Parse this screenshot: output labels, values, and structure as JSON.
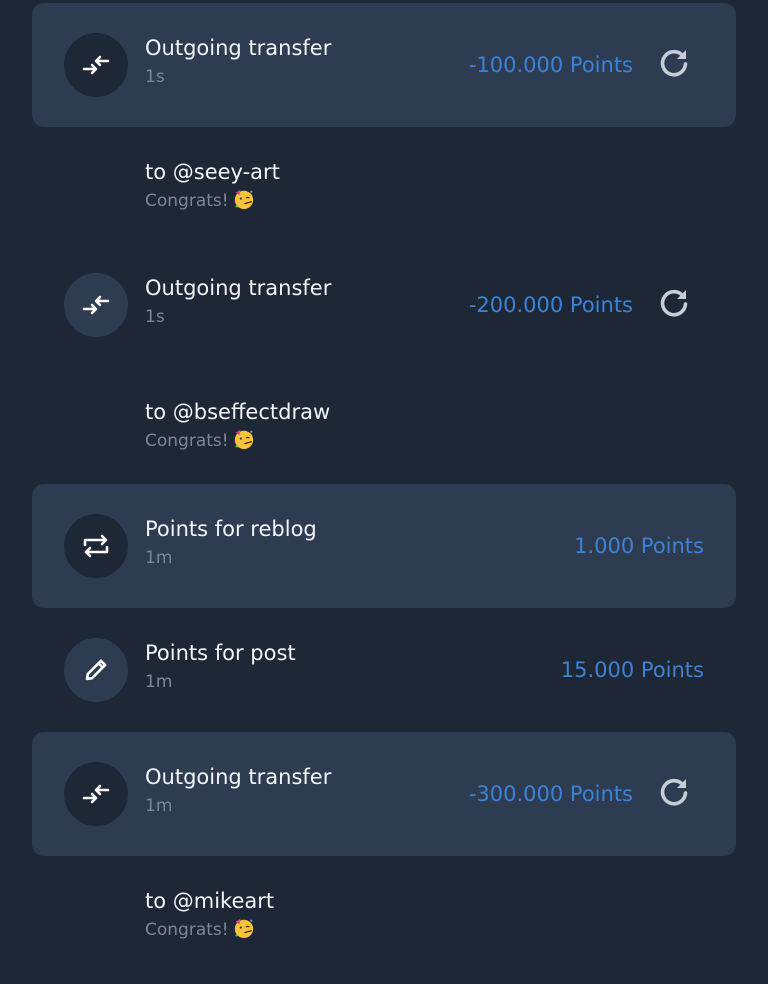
{
  "activities": [
    {
      "type": "transfer",
      "icon": "transfer-icon",
      "title": "Outgoing transfer",
      "time": "1s",
      "amount": "-100.000 Points",
      "highlighted": true,
      "has_repeat": true,
      "memo": {
        "to": "to @seey-art",
        "text": "Congrats!",
        "emoji": "partying-face-emoji"
      }
    },
    {
      "type": "transfer",
      "icon": "transfer-icon",
      "title": "Outgoing transfer",
      "time": "1s",
      "amount": "-200.000 Points",
      "highlighted": false,
      "has_repeat": true,
      "memo": {
        "to": "to @bseffectdraw",
        "text": "Congrats!",
        "emoji": "partying-face-emoji"
      }
    },
    {
      "type": "reblog",
      "icon": "reblog-icon",
      "title": "Points for reblog",
      "time": "1m",
      "amount": "1.000 Points",
      "highlighted": true,
      "has_repeat": false
    },
    {
      "type": "post",
      "icon": "pencil-icon",
      "title": "Points for post",
      "time": "1m",
      "amount": "15.000 Points",
      "highlighted": false,
      "has_repeat": false
    },
    {
      "type": "transfer",
      "icon": "transfer-icon",
      "title": "Outgoing transfer",
      "time": "1m",
      "amount": "-300.000 Points",
      "highlighted": true,
      "has_repeat": true,
      "memo": {
        "to": "to @mikeart",
        "text": "Congrats!",
        "emoji": "partying-face-emoji"
      }
    }
  ],
  "colors": {
    "background": "#1e2735",
    "card_highlight": "#2e3c52",
    "amount": "#3b82d8",
    "primary_text": "#f2f4f7",
    "secondary_text": "#7b8796"
  }
}
